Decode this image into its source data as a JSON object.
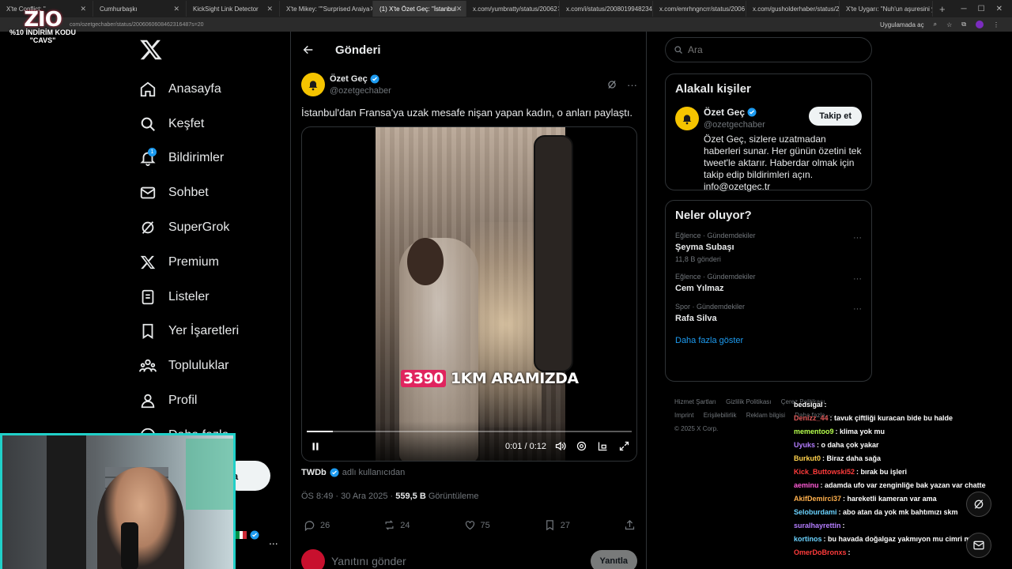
{
  "browser": {
    "tabs": [
      {
        "label": "X'te Conflict: \"",
        "active": false
      },
      {
        "label": "Cumhurbaşkı",
        "active": false
      },
      {
        "label": "KickSight Link Detector",
        "active": false
      },
      {
        "label": "X'te Mikey: \"\"Surprised Araiya",
        "active": false
      },
      {
        "label": "(1) X'te Özet Geç: \"İstanbul",
        "active": true
      },
      {
        "label": "x.com/yumbratty/status/20062",
        "active": false
      },
      {
        "label": "x.com/i/status/20080199482344",
        "active": false
      },
      {
        "label": "x.com/emrhngncrr/status/2006",
        "active": false
      },
      {
        "label": "x.com/gusholderhaber/status/2",
        "active": false
      },
      {
        "label": "X'te Uygarı: \"Nuh'un aşuresini y",
        "active": false
      }
    ],
    "url": "com/ozetgechaber/status/2006060608462316487s=20",
    "app_label": "Uygulamada aç"
  },
  "overlay": {
    "logo_text": "ZIO",
    "promo_line1": "%10 İNDİRİM KODU",
    "promo_line2": "\"CAVS\""
  },
  "nav": {
    "items": [
      {
        "label": "Anasayfa",
        "icon": "home-icon"
      },
      {
        "label": "Keşfet",
        "icon": "search-icon"
      },
      {
        "label": "Bildirimler",
        "icon": "bell-icon",
        "badge": "1"
      },
      {
        "label": "Sohbet",
        "icon": "mail-icon"
      },
      {
        "label": "SuperGrok",
        "icon": "grok-icon"
      },
      {
        "label": "Premium",
        "icon": "x-icon"
      },
      {
        "label": "Listeler",
        "icon": "list-icon"
      },
      {
        "label": "Yer İşaretleri",
        "icon": "bookmark-icon"
      },
      {
        "label": "Topluluklar",
        "icon": "communities-icon"
      },
      {
        "label": "Profil",
        "icon": "profile-icon"
      },
      {
        "label": "Daha fazla",
        "icon": "more-icon"
      }
    ],
    "post_button": "a",
    "account_more": "..."
  },
  "post": {
    "header_title": "Gönderi",
    "author_name": "Özet Geç",
    "author_handle": "@ozetgechaber",
    "text": "İstanbul'dan Fransa'ya uzak mesafe nişan yapan kadın, o anları paylaştı.",
    "video": {
      "caption_number": "3390",
      "caption_text": "1KM ARAMIZDA",
      "time": "0:01 / 0:12",
      "progress": 0.08
    },
    "via_user": "TWDb",
    "via_text": "adlı kullanıcıdan",
    "timestamp": "ÖS 8:49 · 30 Ara 2025 · ",
    "views": "559,5 B",
    "views_label": "Görüntüleme",
    "replies": "26",
    "reposts": "24",
    "likes": "75",
    "bookmarks": "27",
    "reply_placeholder": "Yanıtını gönder",
    "reply_button": "Yanıtla"
  },
  "right": {
    "search_placeholder": "Ara",
    "related_title": "Alakalı kişiler",
    "related_name": "Özet Geç",
    "related_handle": "@ozetgechaber",
    "follow_button": "Takip et",
    "related_bio": "Özet Geç, sizlere uzatmadan haberleri sunar. Her günün özetini tek tweet'le aktarır. Haberdar olmak için takip edip bildirimleri açın. info@ozetgec.tr",
    "trends_title": "Neler oluyor?",
    "trends": [
      {
        "category": "Eğlence · Gündemdekiler",
        "title": "Şeyma Subaşı",
        "count": "11,8 B gönderi"
      },
      {
        "category": "Eğlence · Gündemdekiler",
        "title": "Cem Yılmaz",
        "count": ""
      },
      {
        "category": "Spor · Gündemdekiler",
        "title": "Rafa Silva",
        "count": ""
      }
    ],
    "show_more": "Daha fazla göster",
    "footer": {
      "l1": [
        "Hizmet Şartları",
        "Gizlilik Politikası",
        "Çerez Politikası"
      ],
      "l2": [
        "Imprint",
        "Erişilebilirlik",
        "Reklam bilgisi",
        "Daha fazla ···"
      ],
      "copyright": "© 2025 X Corp."
    }
  },
  "chat": [
    {
      "user": "bedsigal",
      "text": "",
      "color": "#ffffff"
    },
    {
      "user": "Denizz_44",
      "text": "tavuk çiftliği kuracan bide bu halde",
      "color": "#e05b5b"
    },
    {
      "user": "mementoo9",
      "text": "klima yok mu",
      "color": "#b6ff4d"
    },
    {
      "user": "Uyuks",
      "text": "o daha çok yakar",
      "color": "#b47dff"
    },
    {
      "user": "Burkut0",
      "text": "Biraz daha sağa",
      "color": "#ffd24d"
    },
    {
      "user": "Kick_Buttowski52",
      "text": "bırak bu işleri",
      "color": "#ff3b3b"
    },
    {
      "user": "aeminu",
      "text": "adamda ufo var zenginliğe bak yazan var chatte",
      "color": "#ff5bd6"
    },
    {
      "user": "AkifDemirci37",
      "text": "hareketli kameran var ama",
      "color": "#ffb04d"
    },
    {
      "user": "Seloburdami",
      "text": "abo atan da yok mk bahtımızı skm",
      "color": "#6bd3ff"
    },
    {
      "user": "suralhayrettin",
      "text": "",
      "color": "#b47dff"
    },
    {
      "user": "kortinos",
      "text": "bu havada doğalgaz yakmıyon mu cimri misin",
      "color": "#6bd3ff"
    },
    {
      "user": "OmerDoBronxs",
      "text": "",
      "color": "#ff3b3b"
    }
  ]
}
